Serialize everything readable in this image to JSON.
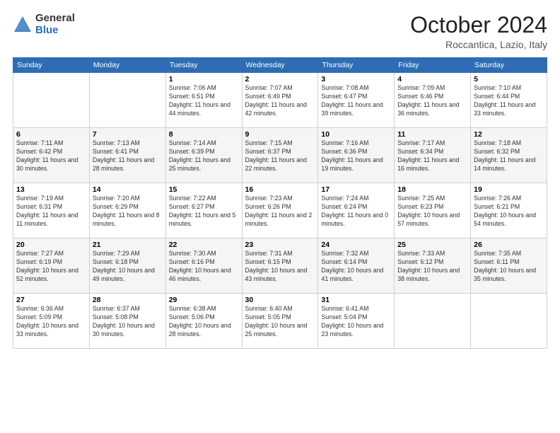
{
  "logo": {
    "general": "General",
    "blue": "Blue"
  },
  "header": {
    "month": "October 2024",
    "location": "Roccantica, Lazio, Italy"
  },
  "weekdays": [
    "Sunday",
    "Monday",
    "Tuesday",
    "Wednesday",
    "Thursday",
    "Friday",
    "Saturday"
  ],
  "weeks": [
    [
      {
        "day": "",
        "sunrise": "",
        "sunset": "",
        "daylight": ""
      },
      {
        "day": "",
        "sunrise": "",
        "sunset": "",
        "daylight": ""
      },
      {
        "day": "1",
        "sunrise": "Sunrise: 7:06 AM",
        "sunset": "Sunset: 6:51 PM",
        "daylight": "Daylight: 11 hours and 44 minutes."
      },
      {
        "day": "2",
        "sunrise": "Sunrise: 7:07 AM",
        "sunset": "Sunset: 6:49 PM",
        "daylight": "Daylight: 11 hours and 42 minutes."
      },
      {
        "day": "3",
        "sunrise": "Sunrise: 7:08 AM",
        "sunset": "Sunset: 6:47 PM",
        "daylight": "Daylight: 11 hours and 39 minutes."
      },
      {
        "day": "4",
        "sunrise": "Sunrise: 7:09 AM",
        "sunset": "Sunset: 6:46 PM",
        "daylight": "Daylight: 11 hours and 36 minutes."
      },
      {
        "day": "5",
        "sunrise": "Sunrise: 7:10 AM",
        "sunset": "Sunset: 6:44 PM",
        "daylight": "Daylight: 11 hours and 33 minutes."
      }
    ],
    [
      {
        "day": "6",
        "sunrise": "Sunrise: 7:11 AM",
        "sunset": "Sunset: 6:42 PM",
        "daylight": "Daylight: 11 hours and 30 minutes."
      },
      {
        "day": "7",
        "sunrise": "Sunrise: 7:13 AM",
        "sunset": "Sunset: 6:41 PM",
        "daylight": "Daylight: 11 hours and 28 minutes."
      },
      {
        "day": "8",
        "sunrise": "Sunrise: 7:14 AM",
        "sunset": "Sunset: 6:39 PM",
        "daylight": "Daylight: 11 hours and 25 minutes."
      },
      {
        "day": "9",
        "sunrise": "Sunrise: 7:15 AM",
        "sunset": "Sunset: 6:37 PM",
        "daylight": "Daylight: 11 hours and 22 minutes."
      },
      {
        "day": "10",
        "sunrise": "Sunrise: 7:16 AM",
        "sunset": "Sunset: 6:36 PM",
        "daylight": "Daylight: 11 hours and 19 minutes."
      },
      {
        "day": "11",
        "sunrise": "Sunrise: 7:17 AM",
        "sunset": "Sunset: 6:34 PM",
        "daylight": "Daylight: 11 hours and 16 minutes."
      },
      {
        "day": "12",
        "sunrise": "Sunrise: 7:18 AM",
        "sunset": "Sunset: 6:32 PM",
        "daylight": "Daylight: 11 hours and 14 minutes."
      }
    ],
    [
      {
        "day": "13",
        "sunrise": "Sunrise: 7:19 AM",
        "sunset": "Sunset: 6:31 PM",
        "daylight": "Daylight: 11 hours and 11 minutes."
      },
      {
        "day": "14",
        "sunrise": "Sunrise: 7:20 AM",
        "sunset": "Sunset: 6:29 PM",
        "daylight": "Daylight: 11 hours and 8 minutes."
      },
      {
        "day": "15",
        "sunrise": "Sunrise: 7:22 AM",
        "sunset": "Sunset: 6:27 PM",
        "daylight": "Daylight: 11 hours and 5 minutes."
      },
      {
        "day": "16",
        "sunrise": "Sunrise: 7:23 AM",
        "sunset": "Sunset: 6:26 PM",
        "daylight": "Daylight: 11 hours and 2 minutes."
      },
      {
        "day": "17",
        "sunrise": "Sunrise: 7:24 AM",
        "sunset": "Sunset: 6:24 PM",
        "daylight": "Daylight: 11 hours and 0 minutes."
      },
      {
        "day": "18",
        "sunrise": "Sunrise: 7:25 AM",
        "sunset": "Sunset: 6:23 PM",
        "daylight": "Daylight: 10 hours and 57 minutes."
      },
      {
        "day": "19",
        "sunrise": "Sunrise: 7:26 AM",
        "sunset": "Sunset: 6:21 PM",
        "daylight": "Daylight: 10 hours and 54 minutes."
      }
    ],
    [
      {
        "day": "20",
        "sunrise": "Sunrise: 7:27 AM",
        "sunset": "Sunset: 6:19 PM",
        "daylight": "Daylight: 10 hours and 52 minutes."
      },
      {
        "day": "21",
        "sunrise": "Sunrise: 7:29 AM",
        "sunset": "Sunset: 6:18 PM",
        "daylight": "Daylight: 10 hours and 49 minutes."
      },
      {
        "day": "22",
        "sunrise": "Sunrise: 7:30 AM",
        "sunset": "Sunset: 6:16 PM",
        "daylight": "Daylight: 10 hours and 46 minutes."
      },
      {
        "day": "23",
        "sunrise": "Sunrise: 7:31 AM",
        "sunset": "Sunset: 6:15 PM",
        "daylight": "Daylight: 10 hours and 43 minutes."
      },
      {
        "day": "24",
        "sunrise": "Sunrise: 7:32 AM",
        "sunset": "Sunset: 6:14 PM",
        "daylight": "Daylight: 10 hours and 41 minutes."
      },
      {
        "day": "25",
        "sunrise": "Sunrise: 7:33 AM",
        "sunset": "Sunset: 6:12 PM",
        "daylight": "Daylight: 10 hours and 38 minutes."
      },
      {
        "day": "26",
        "sunrise": "Sunrise: 7:35 AM",
        "sunset": "Sunset: 6:11 PM",
        "daylight": "Daylight: 10 hours and 35 minutes."
      }
    ],
    [
      {
        "day": "27",
        "sunrise": "Sunrise: 6:36 AM",
        "sunset": "Sunset: 5:09 PM",
        "daylight": "Daylight: 10 hours and 33 minutes."
      },
      {
        "day": "28",
        "sunrise": "Sunrise: 6:37 AM",
        "sunset": "Sunset: 5:08 PM",
        "daylight": "Daylight: 10 hours and 30 minutes."
      },
      {
        "day": "29",
        "sunrise": "Sunrise: 6:38 AM",
        "sunset": "Sunset: 5:06 PM",
        "daylight": "Daylight: 10 hours and 28 minutes."
      },
      {
        "day": "30",
        "sunrise": "Sunrise: 6:40 AM",
        "sunset": "Sunset: 5:05 PM",
        "daylight": "Daylight: 10 hours and 25 minutes."
      },
      {
        "day": "31",
        "sunrise": "Sunrise: 6:41 AM",
        "sunset": "Sunset: 5:04 PM",
        "daylight": "Daylight: 10 hours and 23 minutes."
      },
      {
        "day": "",
        "sunrise": "",
        "sunset": "",
        "daylight": ""
      },
      {
        "day": "",
        "sunrise": "",
        "sunset": "",
        "daylight": ""
      }
    ]
  ]
}
